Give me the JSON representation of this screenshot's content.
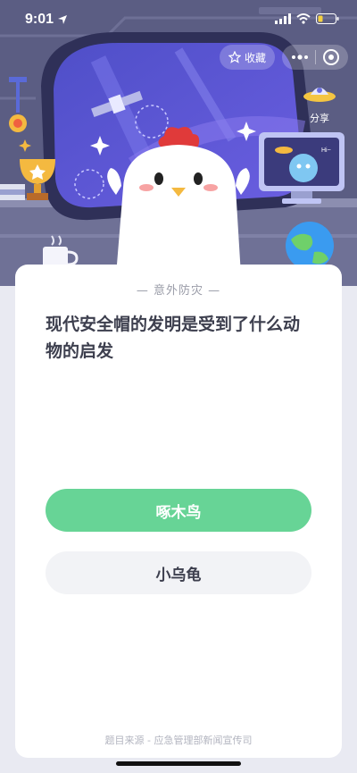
{
  "status_bar": {
    "time": "9:01"
  },
  "toolbar": {
    "favorite_label": "收藏",
    "share_label": "分享"
  },
  "quiz": {
    "category": "— 意外防灾 —",
    "question_line1": "现代安全帽的发明是受到了什么动",
    "question_line2": "物的启发",
    "answers": [
      "啄木鸟",
      "小乌龟"
    ],
    "source": "题目来源 - 应急管理部新闻宣传司"
  },
  "colors": {
    "scene_bg": "#5e6086",
    "correct_green": "#67d496",
    "neutral_option": "#f2f3f6",
    "text_dark": "#3d3f4e"
  },
  "icons": [
    "location-arrow-icon",
    "signal-icon",
    "wifi-icon",
    "battery-icon",
    "star-icon",
    "more-icon",
    "close-target-icon",
    "ufo-icon",
    "trophy-icon",
    "satellite-icon",
    "planet-icon",
    "mug-icon",
    "chicken-mascot"
  ]
}
